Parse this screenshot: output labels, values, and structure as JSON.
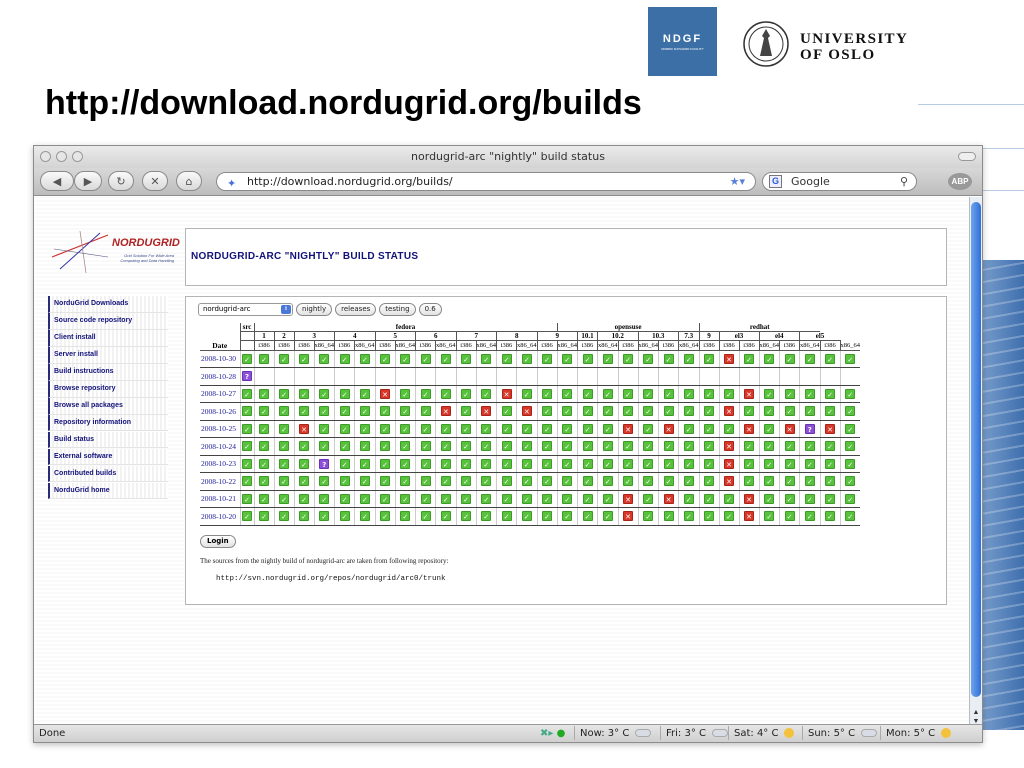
{
  "slide": {
    "title": "http://download.nordugrid.org/builds"
  },
  "logos": {
    "ndgf": "NDGF",
    "ndgf_sub": "NORDIC DATAGRID FACILITY",
    "uio_line1": "UNIVERSITY",
    "uio_line2": "OF OSLO"
  },
  "browser": {
    "window_title": "nordugrid-arc \"nightly\" build status",
    "url": "http://download.nordugrid.org/builds/",
    "search_placeholder": "Google",
    "abp": "ABP",
    "status": "Done",
    "weather": [
      {
        "label": "Now: 3° C",
        "icon": "cloud-icon"
      },
      {
        "label": "Fri: 3° C",
        "icon": "cloud-icon"
      },
      {
        "label": "Sat: 4° C",
        "icon": "sun-cloud-icon"
      },
      {
        "label": "Sun: 5° C",
        "icon": "cloud-icon"
      },
      {
        "label": "Mon: 5° C",
        "icon": "sun-cloud-icon"
      }
    ]
  },
  "page": {
    "logo_text": "NORDUGRID",
    "logo_tag": "Grid Solution For Wide Area Computing and Data Handling",
    "header_title": "NORDUGRID-ARC \"NIGHTLY\" BUILD STATUS",
    "nav": [
      "NorduGrid Downloads",
      "Source code repository",
      "Client install",
      "Server install",
      "Build instructions",
      "Browse repository",
      "Browse all packages",
      "Repository information",
      "Build status",
      "External software",
      "Contributed builds",
      "NorduGrid home"
    ],
    "controls": {
      "select_value": "nordugrid-arc",
      "buttons": [
        "nightly",
        "releases",
        "testing",
        "0.6"
      ]
    },
    "table": {
      "distros": [
        {
          "name": "src",
          "span": 1
        },
        {
          "name": "fedora",
          "span": 15
        },
        {
          "name": "opensuse",
          "span": 7
        },
        {
          "name": "redhat",
          "span": 6
        }
      ],
      "versions": [
        {
          "name": "",
          "span": 1
        },
        {
          "name": "1",
          "span": 1
        },
        {
          "name": "2",
          "span": 1
        },
        {
          "name": "3",
          "span": 2
        },
        {
          "name": "4",
          "span": 2
        },
        {
          "name": "5",
          "span": 2
        },
        {
          "name": "6",
          "span": 2
        },
        {
          "name": "7",
          "span": 2
        },
        {
          "name": "8",
          "span": 2
        },
        {
          "name": "9",
          "span": 2
        },
        {
          "name": "10.1",
          "span": 1
        },
        {
          "name": "10.2",
          "span": 2
        },
        {
          "name": "10.3",
          "span": 2
        },
        {
          "name": "7.3",
          "span": 1
        },
        {
          "name": "9",
          "span": 1
        },
        {
          "name": "el3",
          "span": 2
        },
        {
          "name": "el4",
          "span": 2
        },
        {
          "name": "el5",
          "span": 2
        }
      ],
      "arches": [
        "",
        "i386",
        "i386",
        "i386",
        "x86_64",
        "i386",
        "x86_64",
        "i386",
        "x86_64",
        "i386",
        "x86_64",
        "i386",
        "x86_64",
        "i386",
        "x86_64",
        "i386",
        "x86_64",
        "i386",
        "x86_64",
        "i386",
        "x86_64",
        "i386",
        "x86_64",
        "i386",
        "i386",
        "i386",
        "x86_64",
        "i386",
        "x86_64",
        "i386",
        "x86_64"
      ],
      "date_label": "Date",
      "rows": [
        {
          "date": "2008-10-30",
          "cells": "ooooooooooooooooooooooooxoooooo"
        },
        {
          "date": "2008-10-28",
          "cells": "u------------------------------"
        },
        {
          "date": "2008-10-27",
          "cells": "oooooooxoooooxoooooooooooxooooo"
        },
        {
          "date": "2008-10-26",
          "cells": "ooooooooooxoxoxoooooooooxoooooo"
        },
        {
          "date": "2008-10-25",
          "cells": "oooxoooooooooooooooxoxoooxoxuxox"
        },
        {
          "date": "2008-10-24",
          "cells": "ooooooooooooooooooooooooxoooooox"
        },
        {
          "date": "2008-10-23",
          "cells": "oooouoooooooooooooooooooxoooooo"
        },
        {
          "date": "2008-10-22",
          "cells": "ooooooooooooooooooooooooxoooooo"
        },
        {
          "date": "2008-10-21",
          "cells": "oooooooooooooooooooxoxoooxooooo"
        },
        {
          "date": "2008-10-20",
          "cells": "oooooooooooooooooooxoooooxooooo"
        }
      ]
    },
    "login_label": "Login",
    "note": "The sources from the nightly build of nordugrid-arc are taken from following repository:",
    "repo_url": "http://svn.nordugrid.org/repos/nordugrid/arc0/trunk"
  }
}
